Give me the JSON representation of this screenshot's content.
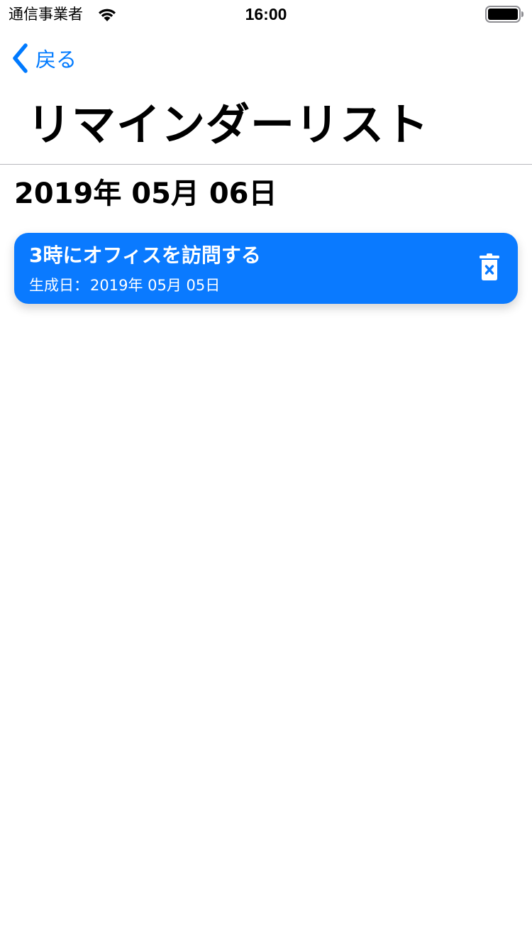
{
  "status_bar": {
    "carrier": "通信事業者",
    "time": "16:00",
    "wifi_icon": "wifi-icon",
    "battery_icon": "battery-full-icon"
  },
  "nav": {
    "back_label": "戻る",
    "back_icon": "chevron-left-icon",
    "title": "リマインダーリスト"
  },
  "section": {
    "date": "2019年 05月 06日"
  },
  "reminders": [
    {
      "title": "3時にオフィスを訪問する",
      "created_label": "生成日：",
      "created_date": "2019年 05月 05日",
      "delete_icon": "trash-delete-icon"
    }
  ],
  "colors": {
    "accent": "#007AFF",
    "card_background": "#0A7AFF",
    "card_text": "#FFFFFF",
    "divider": "#B8B8BD"
  }
}
